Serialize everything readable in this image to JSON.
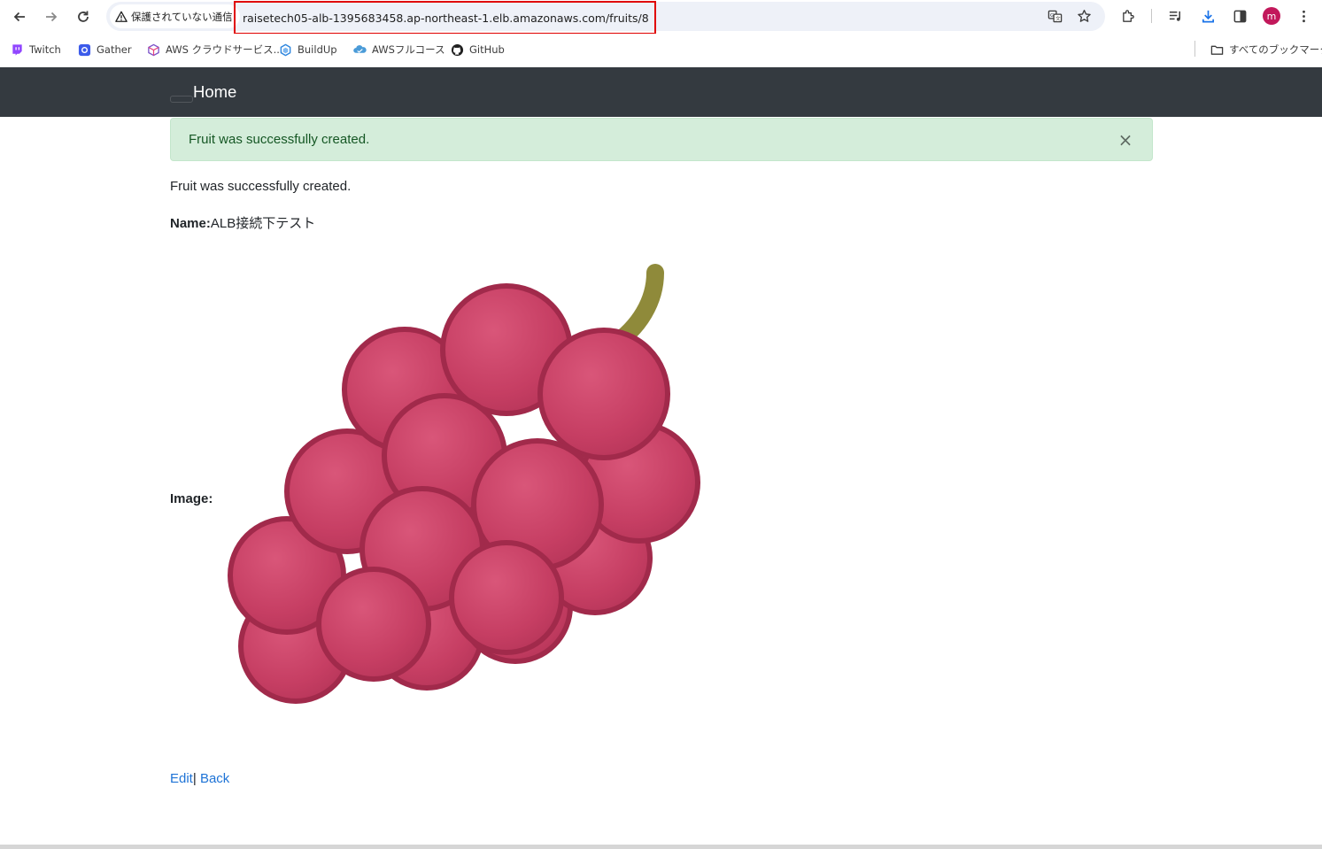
{
  "browser": {
    "security_label": "保護されていない通信",
    "url": "raisetech05-alb-1395683458.ap-northeast-1.elb.amazonaws.com/fruits/8",
    "profile_initial": "m",
    "colors": {
      "url_highlight": "#e00000",
      "profile": "#c2185b"
    }
  },
  "bookmarks": {
    "items": [
      {
        "label": "Twitch",
        "icon": "twitch-icon"
      },
      {
        "label": "Gather",
        "icon": "gather-icon"
      },
      {
        "label": "AWS クラウドサービス...",
        "icon": "aws-cube-icon"
      },
      {
        "label": "BuildUp",
        "icon": "buildup-icon"
      },
      {
        "label": "AWSフルコース",
        "icon": "aws-course-icon"
      },
      {
        "label": "GitHub",
        "icon": "github-icon"
      }
    ],
    "all_bookmarks_label": "すべてのブックマーク"
  },
  "navbar": {
    "brand": "Home"
  },
  "alert": {
    "message": "Fruit was successfully created.",
    "close": "×"
  },
  "notice": "Fruit was successfully created.",
  "fruit": {
    "name_label": "Name:",
    "name": "ALB接続下テスト",
    "image_label": "Image:",
    "image": "grape-image"
  },
  "links": {
    "edit": "Edit",
    "separator": "|",
    "back": "Back"
  }
}
